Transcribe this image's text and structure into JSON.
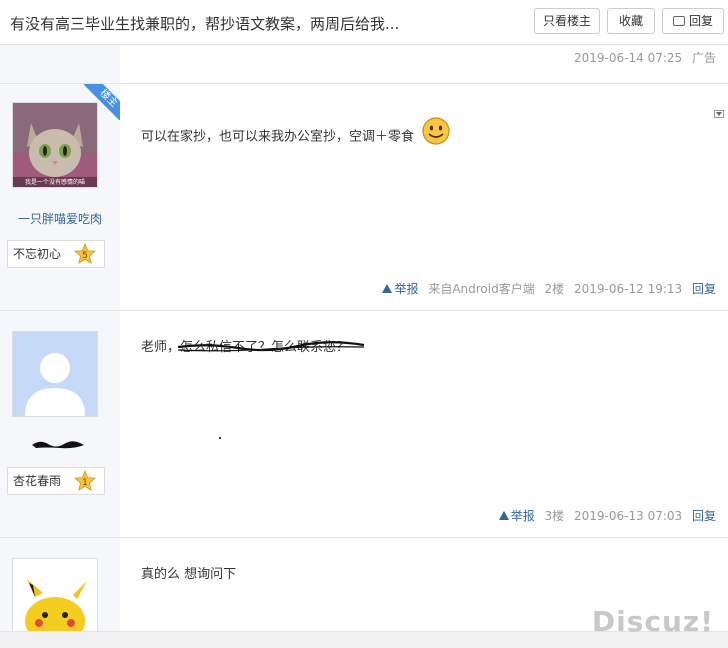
{
  "header": {
    "thread_title": "有没有高三毕业生找兼职的，帮抄语文教案，两周后给我...",
    "btn_only_op": "只看楼主",
    "btn_favorite": "收藏",
    "btn_reply": "回复"
  },
  "ad_row": {
    "timestamp": "2019-06-14 07:25",
    "ad_label": "广告"
  },
  "posts": [
    {
      "is_op": true,
      "op_badge": "楼主",
      "username": "一只胖喵爱吃肉",
      "medal_label": "不忘初心",
      "medal_number": "5",
      "avatar_caption": "我是一个没有感情的喵",
      "content": "可以在家抄，也可以来我办公室抄，空调＋零食",
      "report": "举报",
      "source": "来自Android客户端",
      "floor": "2楼",
      "timestamp": "2019-06-12 19:13",
      "reply": "回复"
    },
    {
      "is_op": false,
      "medal_label": "杏花春雨",
      "medal_number": "1",
      "content": "老师，怎么私信不了？怎么联系您？",
      "report": "举报",
      "floor": "3楼",
      "timestamp": "2019-06-13 07:03",
      "reply": "回复"
    },
    {
      "is_op": false,
      "content": "真的么 想询问下"
    }
  ],
  "watermark": "Discuz!",
  "colors": {
    "link": "#336699",
    "badge_blue": "#4a90e2",
    "sidebar_bg": "#f5f7fa",
    "meta_gray": "#999999",
    "medal_gold": "#f5c242"
  }
}
